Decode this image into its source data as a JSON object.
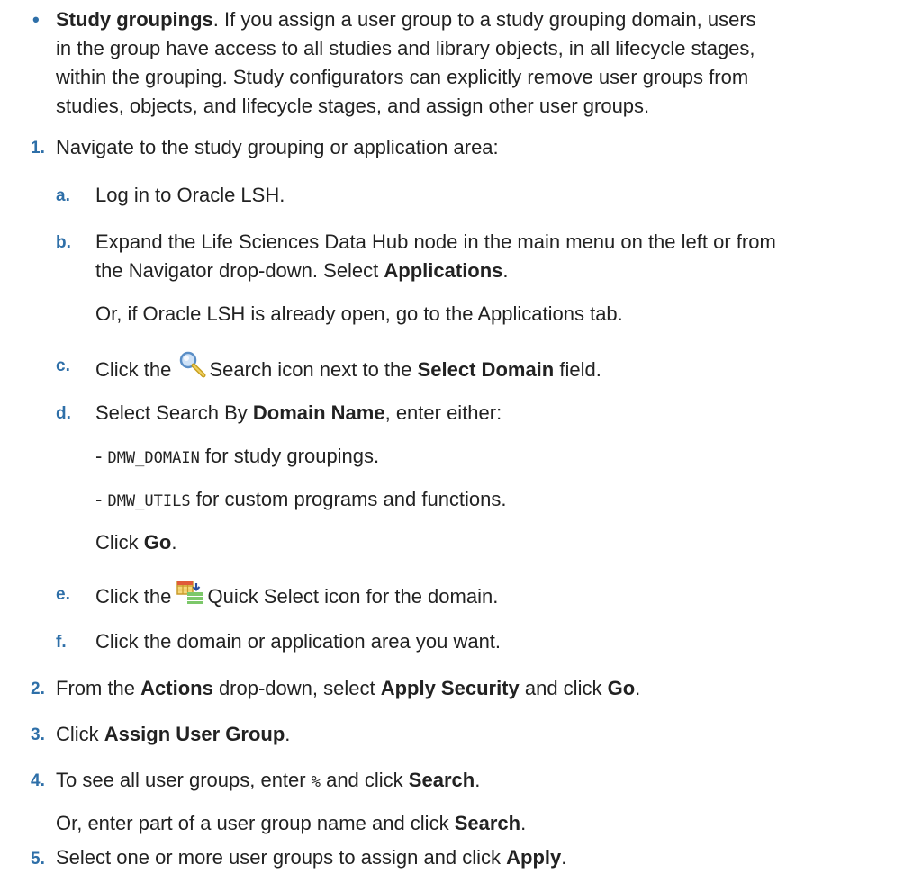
{
  "intro": {
    "bullet": "•",
    "title": "Study groupings",
    "line1_rest": ". If you assign a user group to a study grouping domain, users",
    "line2": "in the group have access to all studies and library objects, in all lifecycle stages,",
    "line3": "within the grouping. Study configurators can explicitly remove user groups from",
    "line4": "studies, objects, and lifecycle stages, and assign other user groups."
  },
  "steps": [
    {
      "num": "1.",
      "text": "Navigate to the study grouping or application area:",
      "substeps": [
        {
          "letter": "a.",
          "text": "Log in to Oracle LSH."
        },
        {
          "letter": "b.",
          "line1": "Expand the Life Sciences Data Hub node in the main menu on the left or from",
          "line2_pre": "the Navigator drop-down. Select ",
          "line2_bold": "Applications",
          "line2_post": ".",
          "note": "Or, if Oracle LSH is already open, go to the Applications tab."
        },
        {
          "letter": "c.",
          "pre": "Click the ",
          "post": "Search icon next to the ",
          "bold": "Select Domain",
          "end": " field."
        },
        {
          "letter": "d.",
          "pre": "Select Search By ",
          "bold": "Domain Name",
          "post": ", enter either:",
          "opt1_dash": "- ",
          "opt1_code": "DMW_DOMAIN",
          "opt1_text": " for study groupings.",
          "opt2_dash": "- ",
          "opt2_code": "DMW_UTILS",
          "opt2_text": " for custom programs and functions.",
          "click_pre": "Click ",
          "click_bold": "Go",
          "click_post": "."
        },
        {
          "letter": "e.",
          "pre": "Click the ",
          "post": "Quick Select icon for the domain."
        },
        {
          "letter": "f.",
          "text": "Click the domain or application area you want."
        }
      ]
    },
    {
      "num": "2.",
      "pre": "From the ",
      "b1": "Actions",
      "mid": " drop-down, select ",
      "b2": "Apply Security",
      "mid2": " and click ",
      "b3": "Go",
      "end": "."
    },
    {
      "num": "3.",
      "pre": "Click ",
      "bold": "Assign User Group",
      "end": "."
    },
    {
      "num": "4.",
      "pre": "To see all user groups, enter ",
      "code": "%",
      "mid": " and click ",
      "bold": "Search",
      "end": ".",
      "note_pre": "Or, enter part of a user group name and click ",
      "note_bold": "Search",
      "note_end": "."
    },
    {
      "num": "5.",
      "pre": "Select one or more user groups to assign and click ",
      "bold": "Apply",
      "end": "."
    }
  ],
  "icons": {
    "search": "magnifier-search-icon",
    "quick_select": "quick-select-table-icon"
  },
  "colors": {
    "marker": "#2e6fa8",
    "text": "#222222"
  }
}
